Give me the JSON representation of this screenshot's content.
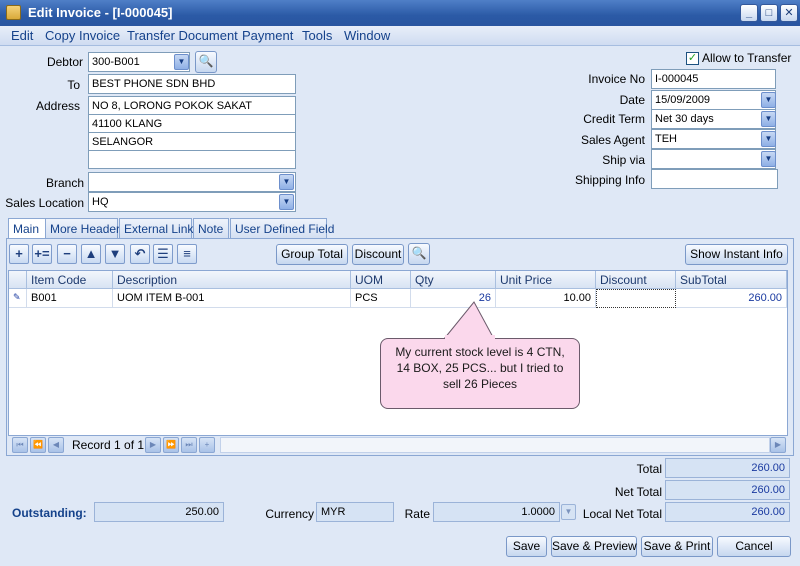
{
  "window": {
    "title": "Edit Invoice - [I-000045]"
  },
  "menu": [
    "Edit",
    "Copy Invoice",
    "Transfer Document",
    "Payment",
    "Tools",
    "Window"
  ],
  "header": {
    "debtor_label": "Debtor",
    "debtor": "300-B001",
    "to_label": "To",
    "to": "BEST PHONE SDN BHD",
    "address_label": "Address",
    "address": [
      "NO 8, LORONG POKOK SAKAT",
      "41100 KLANG",
      "SELANGOR",
      ""
    ],
    "branch_label": "Branch",
    "branch": "",
    "sales_location_label": "Sales Location",
    "sales_location": "HQ",
    "allow_transfer_label": "Allow to Transfer",
    "invoice_no_label": "Invoice No",
    "invoice_no": "I-000045",
    "date_label": "Date",
    "date": "15/09/2009",
    "credit_term_label": "Credit Term",
    "credit_term": "Net 30 days",
    "sales_agent_label": "Sales Agent",
    "sales_agent": "TEH",
    "ship_via_label": "Ship via",
    "ship_via": "",
    "shipping_info_label": "Shipping Info",
    "shipping_info": ""
  },
  "tabs": [
    "Main",
    "More Header",
    "External Link",
    "Note",
    "User Defined Field"
  ],
  "toolbar": {
    "group_total": "Group Total",
    "discount": "Discount",
    "show_instant_info": "Show Instant Info"
  },
  "grid": {
    "columns": [
      "Item Code",
      "Description",
      "UOM",
      "Qty",
      "Unit Price",
      "Discount",
      "SubTotal"
    ],
    "rows": [
      {
        "item_code": "B001",
        "description": "UOM ITEM B-001",
        "uom": "PCS",
        "qty": "26",
        "unit_price": "10.00",
        "discount": "",
        "subtotal": "260.00"
      }
    ]
  },
  "callout": "My current stock level is 4 CTN, 14 BOX, 25 PCS... but I tried to sell 26 Pieces",
  "nav": {
    "record": "Record 1 of 1"
  },
  "footer": {
    "outstanding_label": "Outstanding:",
    "outstanding": "250.00",
    "currency_label": "Currency",
    "currency": "MYR",
    "rate_label": "Rate",
    "rate": "1.0000",
    "total_label": "Total",
    "total": "260.00",
    "net_total_label": "Net Total",
    "net_total": "260.00",
    "local_net_total_label": "Local Net Total",
    "local_net_total": "260.00"
  },
  "buttons": {
    "save": "Save",
    "save_preview": "Save & Preview",
    "save_print": "Save & Print",
    "cancel": "Cancel"
  },
  "colors": {
    "title_bar": "#2b5aa6",
    "background": "#dfe8f6",
    "callout": "#fbd8ec",
    "outstanding": "#15428b"
  }
}
